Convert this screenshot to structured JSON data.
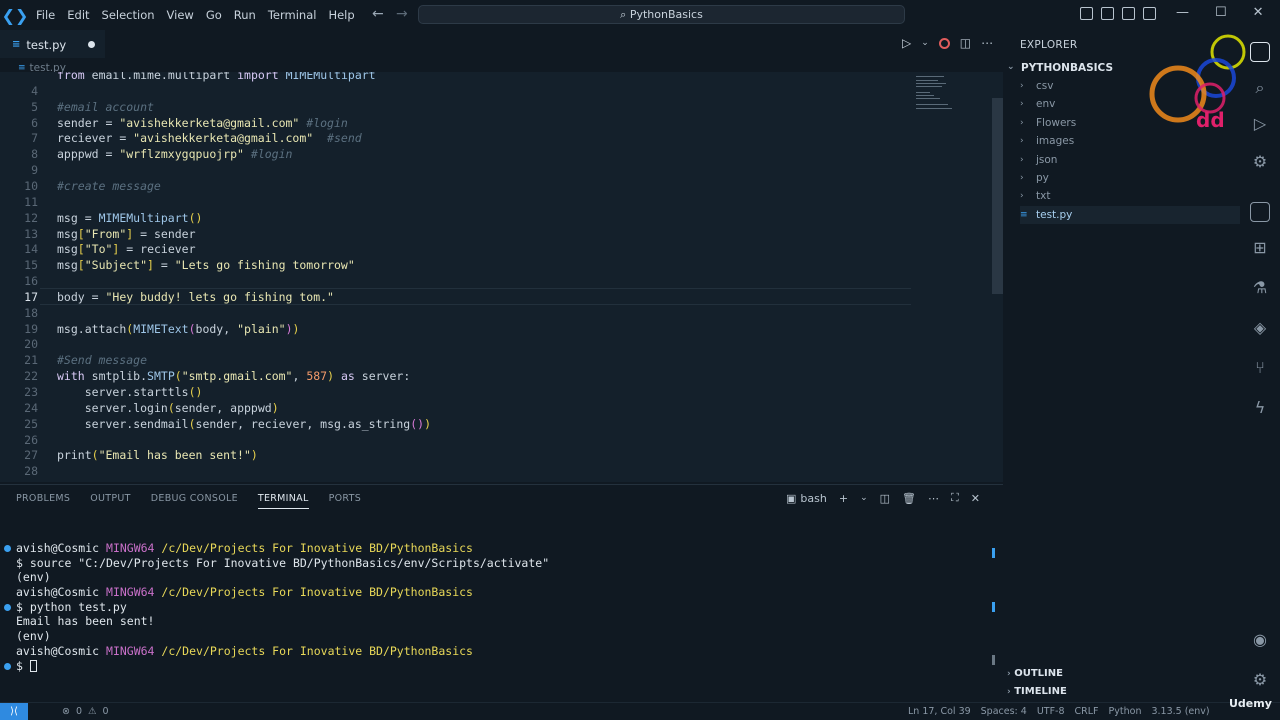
{
  "titlebar": {
    "menu": [
      "File",
      "Edit",
      "Selection",
      "View",
      "Go",
      "Run",
      "Terminal",
      "Help"
    ],
    "command_center": "PythonBasics",
    "back_icon": "arrow-left-icon",
    "forward_icon": "arrow-right-icon"
  },
  "tab": {
    "label": "test.py",
    "modified": true
  },
  "breadcrumb": {
    "file": "test.py"
  },
  "editor": {
    "current_line": 17,
    "lines": [
      {
        "n": "",
        "text": "from email.mime.multipart import MIMEMultipart"
      },
      {
        "n": "4",
        "text": ""
      },
      {
        "n": "5",
        "text": "#email account"
      },
      {
        "n": "6",
        "text": "sender = \"avishekkerketa@gmail.com\" #login"
      },
      {
        "n": "7",
        "text": "reciever = \"avishekkerketa@gmail.com\"  #send"
      },
      {
        "n": "8",
        "text": "apppwd = \"wrflzmxygqpuojrp\" #login"
      },
      {
        "n": "9",
        "text": ""
      },
      {
        "n": "10",
        "text": "#create message"
      },
      {
        "n": "11",
        "text": ""
      },
      {
        "n": "12",
        "text": "msg = MIMEMultipart()"
      },
      {
        "n": "13",
        "text": "msg[\"From\"] = sender"
      },
      {
        "n": "14",
        "text": "msg[\"To\"] = reciever"
      },
      {
        "n": "15",
        "text": "msg[\"Subject\"] = \"Lets go fishing tomorrow\""
      },
      {
        "n": "16",
        "text": ""
      },
      {
        "n": "17",
        "text": "body = \"Hey buddy! lets go fishing tom.\""
      },
      {
        "n": "18",
        "text": ""
      },
      {
        "n": "19",
        "text": "msg.attach(MIMEText(body, \"plain\"))"
      },
      {
        "n": "20",
        "text": ""
      },
      {
        "n": "21",
        "text": "#Send message"
      },
      {
        "n": "22",
        "text": "with smtplib.SMTP(\"smtp.gmail.com\", 587) as server:"
      },
      {
        "n": "23",
        "text": "    server.starttls()"
      },
      {
        "n": "24",
        "text": "    server.login(sender, apppwd)"
      },
      {
        "n": "25",
        "text": "    server.sendmail(sender, reciever, msg.as_string())"
      },
      {
        "n": "26",
        "text": ""
      },
      {
        "n": "27",
        "text": "print(\"Email has been sent!\")"
      },
      {
        "n": "28",
        "text": ""
      }
    ]
  },
  "panel": {
    "tabs": [
      "PROBLEMS",
      "OUTPUT",
      "DEBUG CONSOLE",
      "TERMINAL",
      "PORTS"
    ],
    "active_tab": "TERMINAL",
    "terminal_name": "bash",
    "terminal": [
      {
        "mark": true,
        "user": "avish@Cosmic",
        "mingw": "MINGW64",
        "path": "/c/Dev/Projects For Inovative BD/PythonBasics"
      },
      {
        "text": "$ source \"C:/Dev/Projects For Inovative BD/PythonBasics/env/Scripts/activate\""
      },
      {
        "text": "(env)"
      },
      {
        "user": "avish@Cosmic",
        "mingw": "MINGW64",
        "path": "/c/Dev/Projects For Inovative BD/PythonBasics"
      },
      {
        "mark": true,
        "text": "$ python test.py"
      },
      {
        "text": "Email has been sent!"
      },
      {
        "text": "(env)"
      },
      {
        "user": "avish@Cosmic",
        "mingw": "MINGW64",
        "path": "/c/Dev/Projects For Inovative BD/PythonBasics"
      },
      {
        "mark": true,
        "text": "$ ",
        "cursor": true
      }
    ]
  },
  "explorer": {
    "title": "EXPLORER",
    "root": "PYTHONBASICS",
    "items": [
      "csv",
      "env",
      "Flowers",
      "images",
      "json",
      "py",
      "txt",
      "test.py"
    ],
    "selected": "test.py",
    "outline": "OUTLINE",
    "timeline": "TIMELINE"
  },
  "statusbar": {
    "errors": "0",
    "warnings": "0",
    "position": "Ln 17, Col 39",
    "spaces": "Spaces: 4",
    "encoding": "UTF-8",
    "eol": "CRLF",
    "language": "Python",
    "version": "3.13.5 (env)"
  },
  "watermarks": {
    "brand": "Udemy",
    "logo_text": "dd"
  },
  "colors": {
    "accent": "#2f8ae0",
    "editor_bg": "#14202b",
    "chrome_bg": "#101922"
  }
}
